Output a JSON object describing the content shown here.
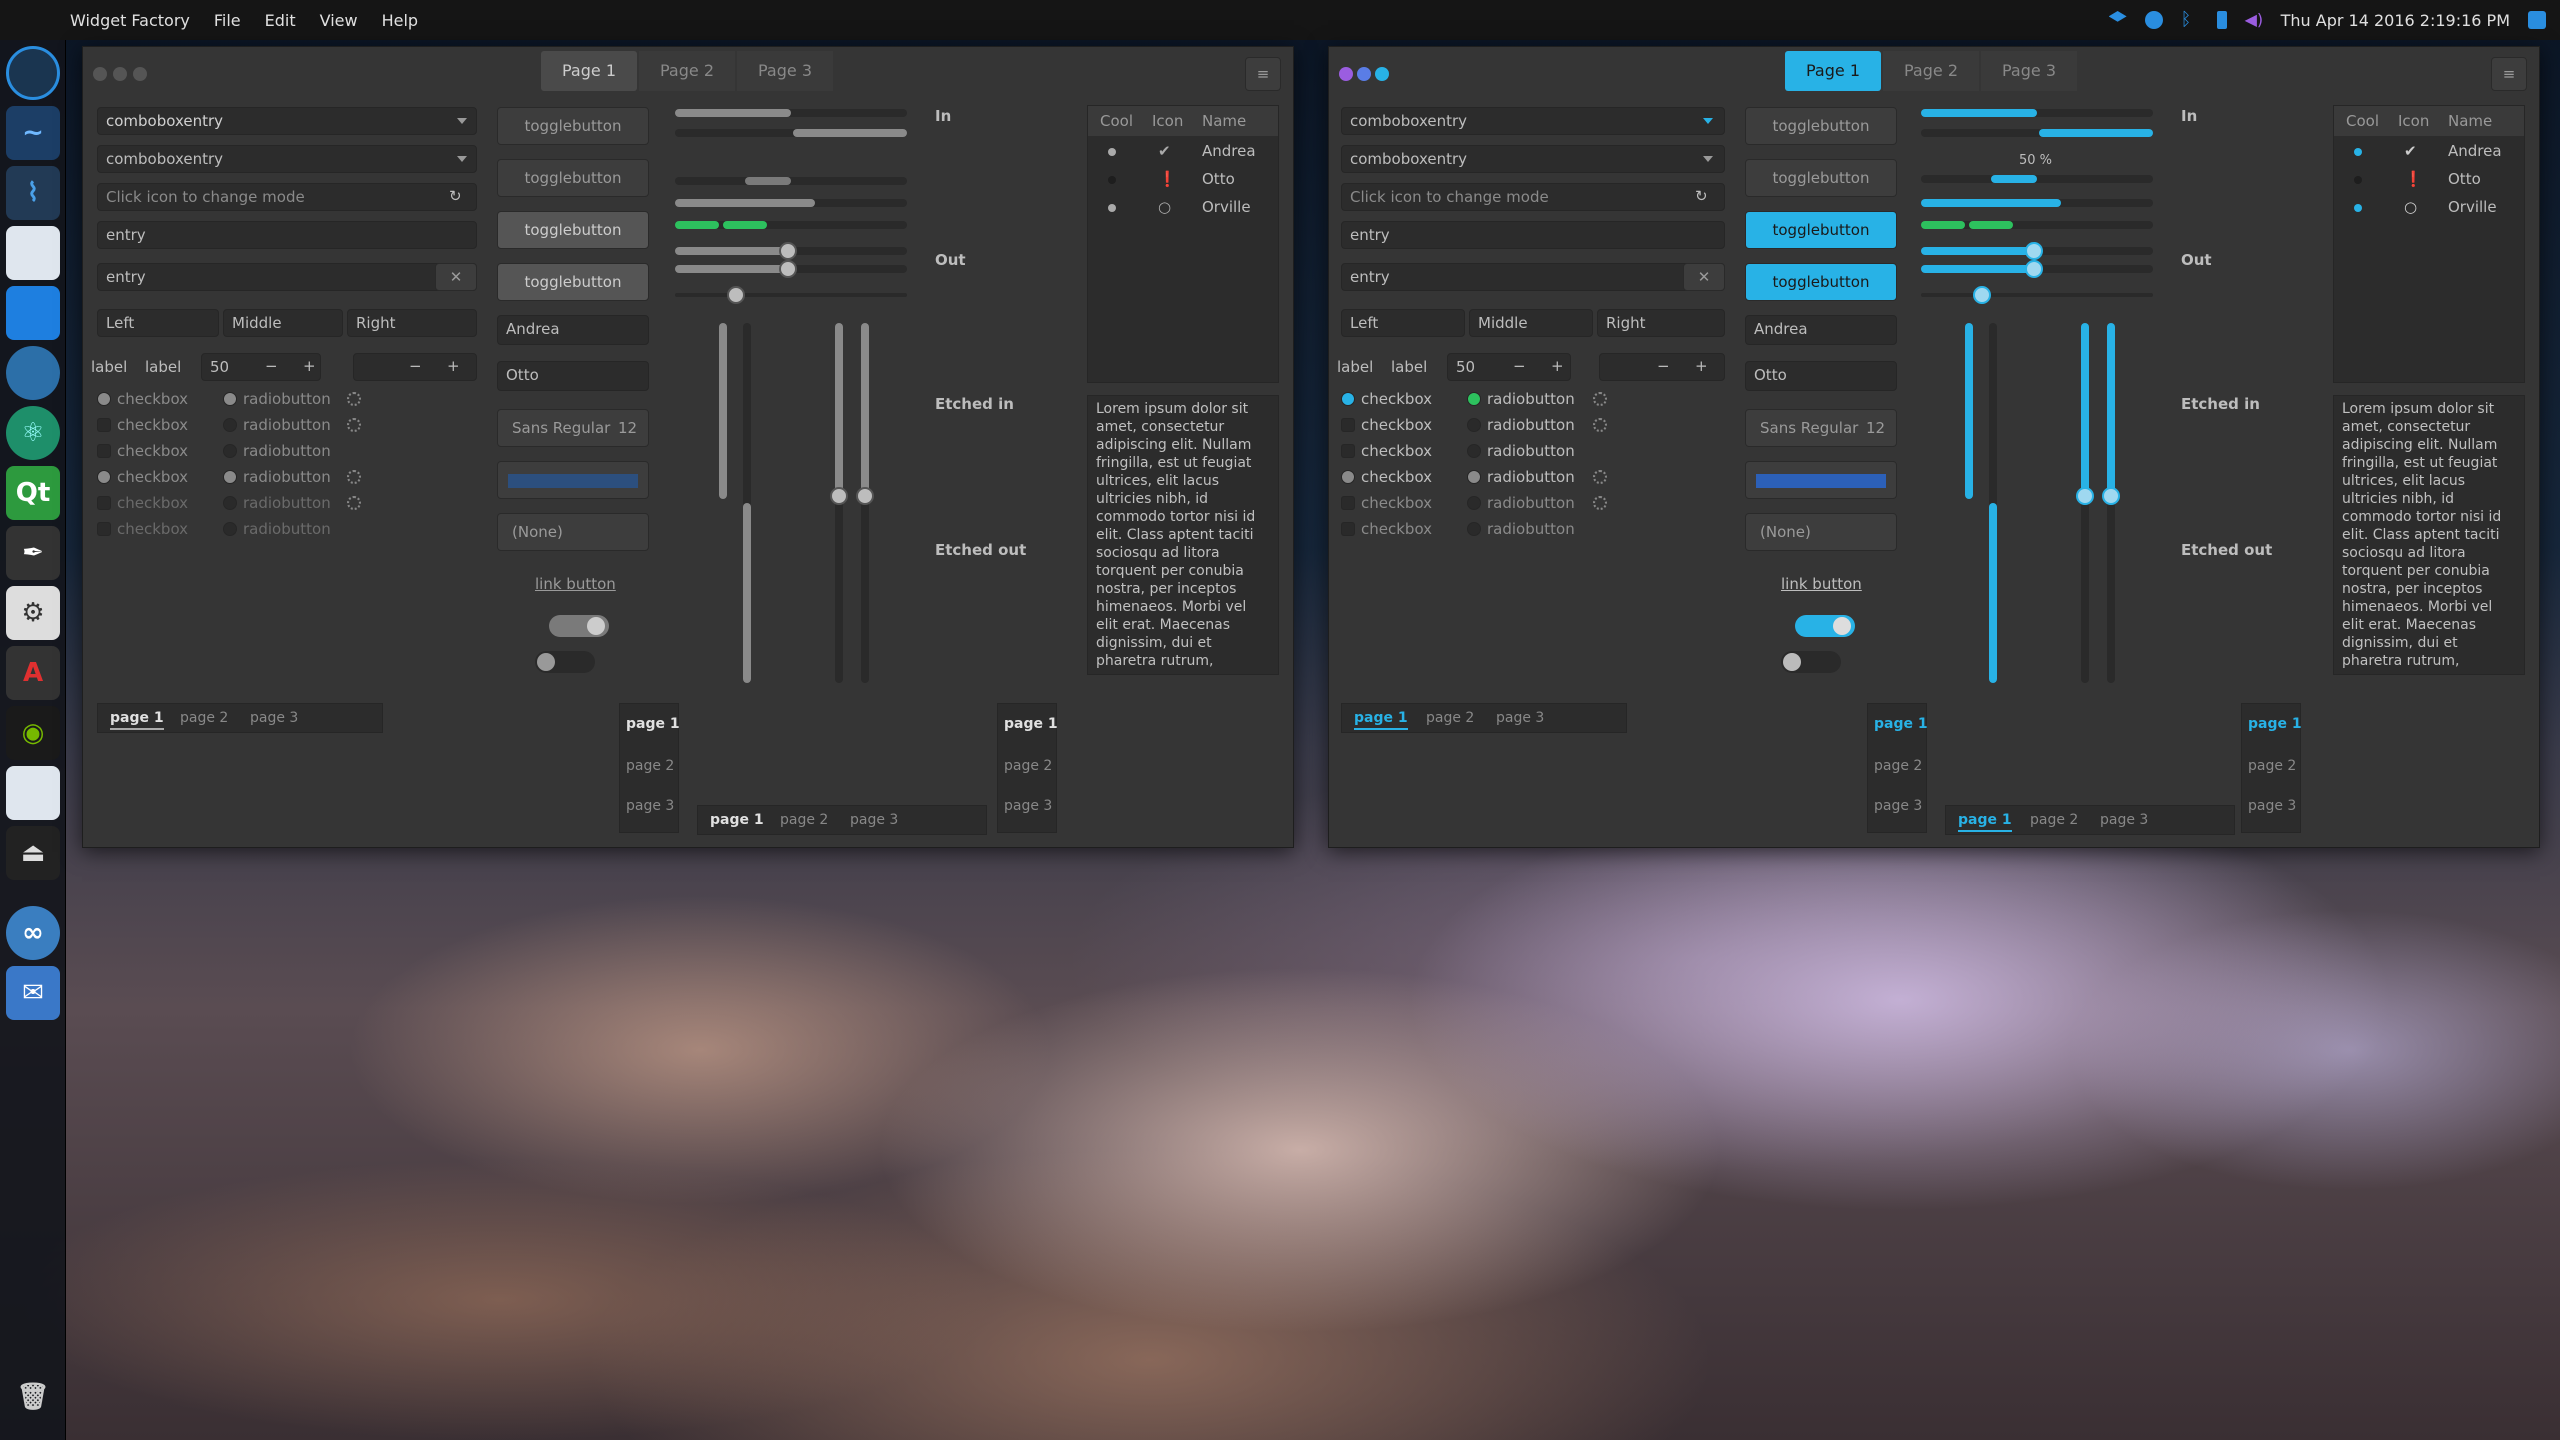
{
  "app": {
    "title": "Widget Factory",
    "menus": [
      "File",
      "Edit",
      "View",
      "Help"
    ]
  },
  "clock": "Thu Apr 14 2016  2:19:16 PM",
  "colors": {
    "accent": "#28b2e6",
    "green": "#2dc15e",
    "disabled": "#7a7a7a",
    "blue_fill": "#2c60b8"
  },
  "window": {
    "tabs": [
      "Page 1",
      "Page 2",
      "Page 3"
    ],
    "combo1": "comboboxentry",
    "combo2": "comboboxentry",
    "entry_mode_placeholder": "Click icon to change mode",
    "entry1": "entry",
    "entry2": "entry",
    "align_left": "Left",
    "align_middle": "Middle",
    "align_right": "Right",
    "label": "label",
    "spin_value": "50",
    "minus": "−",
    "plus": "+",
    "checkbox": "checkbox",
    "radiobutton": "radiobutton",
    "toggle": "togglebutton",
    "combo_andrea": "Andrea",
    "combo_otto": "Otto",
    "font_name": "Sans Regular",
    "font_size": "12",
    "file_none": "(None)",
    "link": "link button",
    "frames": {
      "in": "In",
      "out": "Out",
      "etched_in": "Etched in",
      "etched_out": "Etched out"
    },
    "progress_label": "50 %",
    "tree": {
      "columns": [
        "Cool",
        "Icon",
        "Name"
      ],
      "rows": [
        "Andrea",
        "Otto",
        "Orville"
      ]
    },
    "lorem": "Lorem ipsum dolor sit amet, consectetur adipiscing elit. Nullam fringilla, est ut feugiat ultrices, elit lacus ultricies nibh, id commodo tortor nisi id elit. Class aptent taciti sociosqu ad litora torquent per conubia nostra, per inceptos himenaeos. Morbi vel elit erat. Maecenas dignissim, dui et pharetra rutrum,",
    "small_tabs": [
      "page 1",
      "page 2",
      "page 3"
    ]
  }
}
